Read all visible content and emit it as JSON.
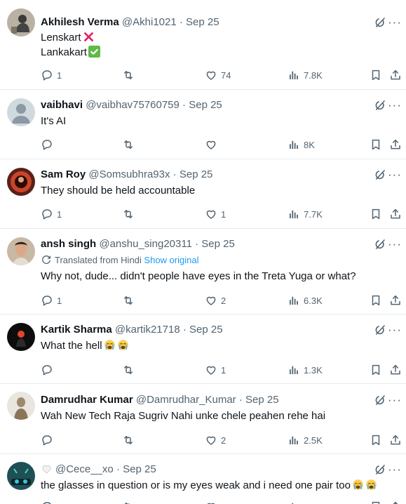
{
  "tweets": [
    {
      "name": "Akhilesh Verma",
      "handle": "@Akhi1021",
      "dot": "·",
      "date": "Sep 25",
      "lines": [
        "Lenskart",
        "Lankakart"
      ],
      "line_marks": [
        "cross-mark",
        "check-mark"
      ],
      "replies": "1",
      "retweets": "",
      "likes": "74",
      "views": "7.8K",
      "avatar": "photo",
      "avatar_color": "#b9b1a3"
    },
    {
      "name": "vaibhavi",
      "handle": "@vaibhav75760759",
      "dot": "·",
      "date": "Sep 25",
      "lines": [
        "It's  AI"
      ],
      "replies": "",
      "retweets": "",
      "likes": "",
      "views": "8K",
      "avatar": "default-person",
      "avatar_color": "#cfd9de"
    },
    {
      "name": "Sam Roy",
      "handle": "@Somsubhra93x",
      "dot": "·",
      "date": "Sep 25",
      "lines": [
        "They should be held accountable"
      ],
      "replies": "1",
      "retweets": "",
      "likes": "1",
      "views": "7.7K",
      "avatar": "photo",
      "avatar_color": "#5a1f18"
    },
    {
      "name": "ansh singh",
      "handle": "@anshu_sing20311",
      "dot": "·",
      "date": "Sep 25",
      "translated": "Translated from Hindi",
      "show_original": "Show original",
      "lines": [
        "Why not, dude... didn't people have eyes in the Treta Yuga or what?"
      ],
      "replies": "1",
      "retweets": "",
      "likes": "2",
      "views": "6.3K",
      "avatar": "photo",
      "avatar_color": "#c8b8a4"
    },
    {
      "name": "Kartik Sharma",
      "handle": "@kartik21718",
      "dot": "·",
      "date": "Sep 25",
      "lines": [
        "What the hell"
      ],
      "emoji_after": 2,
      "replies": "",
      "retweets": "",
      "likes": "1",
      "views": "1.3K",
      "avatar": "photo",
      "avatar_color": "#0d0d0d"
    },
    {
      "name": "Damrudhar Kumar",
      "handle": "@Damrudhar_Kumar",
      "dot": "·",
      "date": "Sep 25",
      "lines": [
        "Wah New Tech Raja Sugriv Nahi unke chele peahen rehe hai"
      ],
      "replies": "",
      "retweets": "",
      "likes": "2",
      "views": "2.5K",
      "avatar": "photo",
      "avatar_color": "#9c8a6e"
    },
    {
      "name": "",
      "handle": "@Cece__xo",
      "dot": "·",
      "date": "Sep 25",
      "lines": [
        "the glasses in question or is my eyes weak and i need one pair too"
      ],
      "emoji_after": 2,
      "name_heart": true,
      "replies": "",
      "retweets": "",
      "likes": "",
      "views": "",
      "avatar": "photo",
      "avatar_color": "#1f4f57"
    }
  ],
  "icons": {
    "reply": "speech-bubble-icon",
    "retweet": "retweet-icon",
    "like": "heart-icon",
    "views": "bar-chart-icon",
    "bookmark": "bookmark-icon",
    "share": "share-upload-icon",
    "grok": "grok-slash-icon",
    "more": "ellipsis-icon"
  },
  "colors": {
    "text": "#0f1419",
    "secondary": "#536471",
    "link": "#1d9bf0",
    "divider": "#e6ecf0",
    "cross": "#e0245e",
    "check": "#5fba46"
  }
}
